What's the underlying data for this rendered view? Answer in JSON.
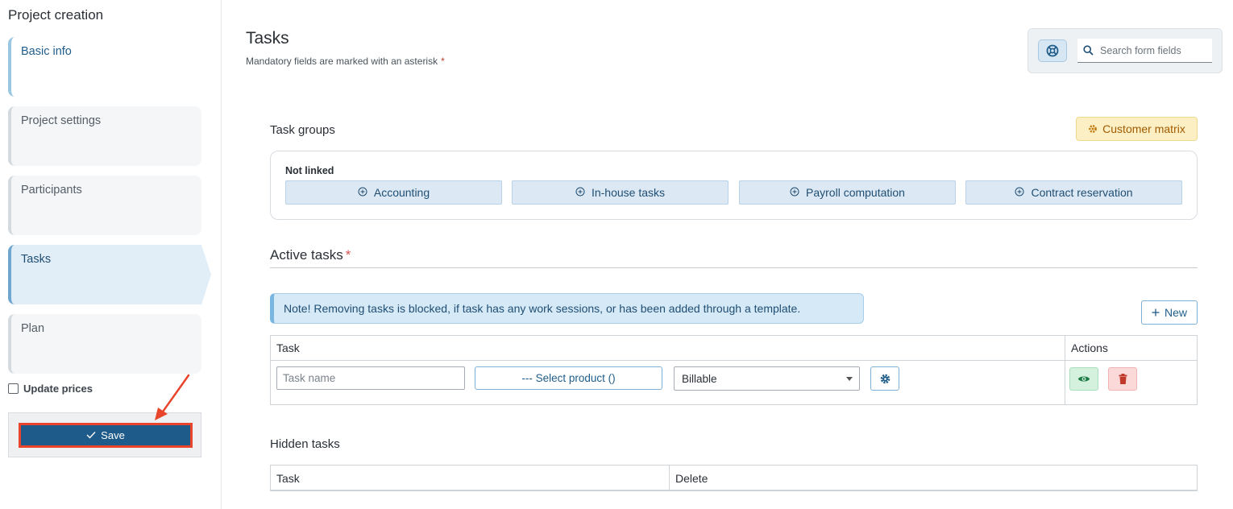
{
  "sidebar": {
    "title": "Project creation",
    "steps": [
      {
        "label": "Basic info"
      },
      {
        "label": "Project settings"
      },
      {
        "label": "Participants"
      },
      {
        "label": "Tasks"
      },
      {
        "label": "Plan"
      }
    ],
    "update_prices_label": "Update prices",
    "update_prices_checked": false,
    "save_label": "Save"
  },
  "header": {
    "title": "Tasks",
    "mandatory_note": "Mandatory fields are marked with an asterisk",
    "mandatory_star": "*",
    "search_placeholder": "Search form fields"
  },
  "task_groups": {
    "label": "Task groups",
    "customer_matrix_label": "Customer matrix",
    "not_linked_label": "Not linked",
    "groups": [
      {
        "label": "Accounting"
      },
      {
        "label": "In-house tasks"
      },
      {
        "label": "Payroll computation"
      },
      {
        "label": "Contract reservation"
      }
    ]
  },
  "active_tasks": {
    "label": "Active tasks",
    "required_star": "*",
    "note": "Note! Removing tasks is blocked, if task has any work sessions, or has been added through a template.",
    "new_button_label": "New",
    "columns": {
      "task": "Task",
      "actions": "Actions"
    },
    "row": {
      "task_name_placeholder": "Task name",
      "select_product_label": "--- Select product ()",
      "billing_value": "Billable"
    }
  },
  "hidden_tasks": {
    "label": "Hidden tasks",
    "columns": {
      "task": "Task",
      "delete": "Delete"
    }
  },
  "colors": {
    "primary": "#1e5b8a",
    "annotation_red": "#e8452c",
    "note_bg": "#d6e9f6",
    "warning_bg": "#fcefc4"
  }
}
